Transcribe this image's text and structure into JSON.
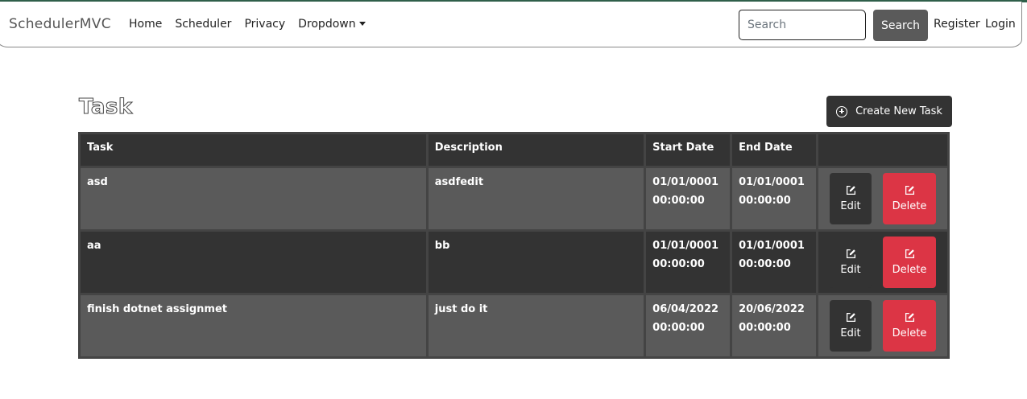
{
  "navbar": {
    "brand": "SchedulerMVC",
    "links": [
      "Home",
      "Scheduler",
      "Privacy",
      "Dropdown"
    ],
    "search_placeholder": "Search",
    "search_button": "Search",
    "register": "Register",
    "login": "Login"
  },
  "page": {
    "title": "Task",
    "create_button": "Create New Task"
  },
  "table": {
    "headers": [
      "Task",
      "Description",
      "Start Date",
      "End Date",
      ""
    ],
    "rows": [
      {
        "task": "asd",
        "description": "asdfedit",
        "start_date": "01/01/0001",
        "start_time": "00:00:00",
        "end_date": "01/01/0001",
        "end_time": "00:00:00"
      },
      {
        "task": "aa",
        "description": "bb",
        "start_date": "01/01/0001",
        "start_time": "00:00:00",
        "end_date": "01/01/0001",
        "end_time": "00:00:00"
      },
      {
        "task": "finish dotnet assignmet",
        "description": "just do it",
        "start_date": "06/04/2022",
        "start_time": "00:00:00",
        "end_date": "20/06/2022",
        "end_time": "00:00:00"
      }
    ],
    "edit_label": "Edit",
    "delete_label": "Delete"
  },
  "colors": {
    "dark": "#333333",
    "row_light": "#5a5a5a",
    "danger": "#dc3545",
    "accent_line": "#2f5f4a"
  },
  "icons": {
    "create": "plus-circle-icon",
    "edit": "pencil-square-icon",
    "delete": "pencil-square-icon",
    "dropdown": "caret-down-icon"
  }
}
